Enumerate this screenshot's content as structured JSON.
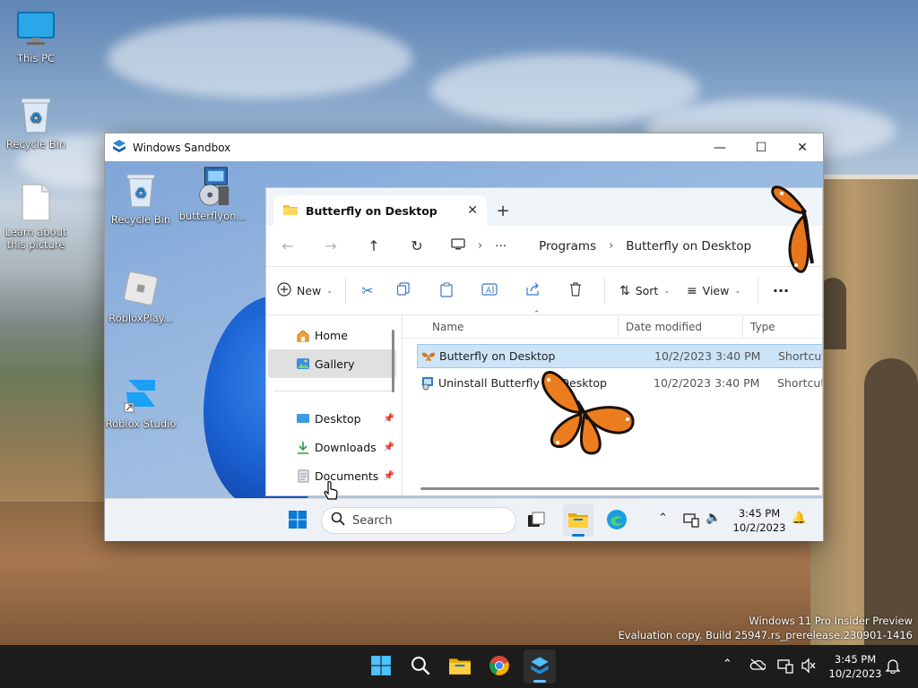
{
  "desktop": {
    "icons": [
      {
        "label": "This PC"
      },
      {
        "label": "Recycle Bin"
      },
      {
        "label": "Learn about this picture"
      }
    ],
    "watermark": {
      "line1": "Windows 11 Pro Insider Preview",
      "line2": "Evaluation copy. Build 25947.rs_prerelease.230901-1416"
    }
  },
  "sandbox": {
    "title": "Windows Sandbox",
    "controls": {
      "minimize": "—",
      "maximize": "☐",
      "close": "✕"
    },
    "desktop_icons": [
      {
        "label": "Recycle Bin"
      },
      {
        "label": "butterflyon..."
      },
      {
        "label": "RobloxPlay..."
      },
      {
        "label": "Roblox Studio"
      }
    ],
    "taskbar": {
      "search_placeholder": "Search",
      "time": "3:45 PM",
      "date": "10/2/2023"
    }
  },
  "explorer": {
    "tab_label": "Butterfly on Desktop",
    "tab_close": "✕",
    "new_tab": "+",
    "breadcrumb": {
      "more": "···",
      "items": [
        "Programs",
        "Butterfly on Desktop"
      ],
      "sep": "›"
    },
    "toolbar": {
      "new_label": "New",
      "sort_label": "Sort",
      "view_label": "View",
      "more": "···"
    },
    "nav": {
      "items": [
        {
          "label": "Home"
        },
        {
          "label": "Gallery"
        },
        {
          "label": "Desktop"
        },
        {
          "label": "Downloads"
        },
        {
          "label": "Documents"
        }
      ]
    },
    "columns": {
      "name": "Name",
      "date": "Date modified",
      "type": "Type"
    },
    "files": [
      {
        "name": "Butterfly on Desktop",
        "date": "10/2/2023 3:40 PM",
        "type": "Shortcut"
      },
      {
        "name": "Uninstall Butterfly on Desktop",
        "date": "10/2/2023 3:40 PM",
        "type": "Shortcut"
      }
    ]
  },
  "host_taskbar": {
    "time": "3:45 PM",
    "date": "10/2/2023"
  },
  "colors": {
    "accent": "#0067c0",
    "selection": "#cce4f7",
    "butterfly": "#e2781e"
  }
}
